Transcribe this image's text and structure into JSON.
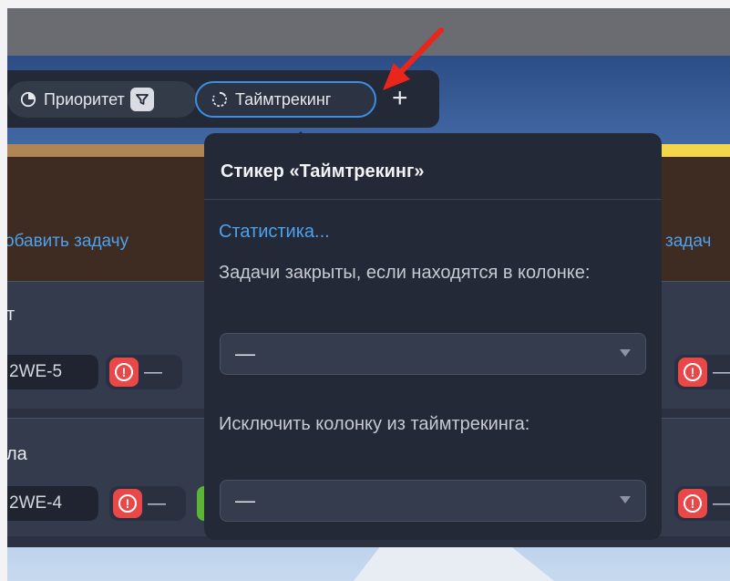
{
  "toolbar": {
    "priority_chip_label": "Приоритет",
    "timetracking_chip_label": "Таймтрекинг",
    "add_label": "+"
  },
  "board": {
    "add_task_left": "обавить задачу",
    "add_task_right": "задач",
    "cards": [
      {
        "title": "т",
        "ticket": "2WE-5",
        "priority_value": "—"
      },
      {
        "title": "ла",
        "ticket": "2WE-4",
        "priority_value": "—"
      }
    ],
    "right_cards": [
      {
        "priority_value": "—"
      },
      {
        "priority_value": "—"
      }
    ]
  },
  "popover": {
    "title": "Стикер «Таймтрекинг»",
    "statistics_link": "Статистика...",
    "closed_label": "Задачи закрыты, если находятся в колонке:",
    "closed_select_value": "—",
    "exclude_label": "Исключить колонку из таймтрекинга:",
    "exclude_select_value": "—"
  },
  "colors": {
    "accent": "#3b8fe6",
    "link": "#4ea1ec",
    "priority_red": "#e84848",
    "annotation_arrow": "#e8261c"
  },
  "icons": [
    "pie-chart-icon",
    "filter-icon",
    "timer-icon",
    "plus-icon",
    "alert-icon",
    "dropdown-arrow-icon",
    "annotation-arrow-icon"
  ]
}
